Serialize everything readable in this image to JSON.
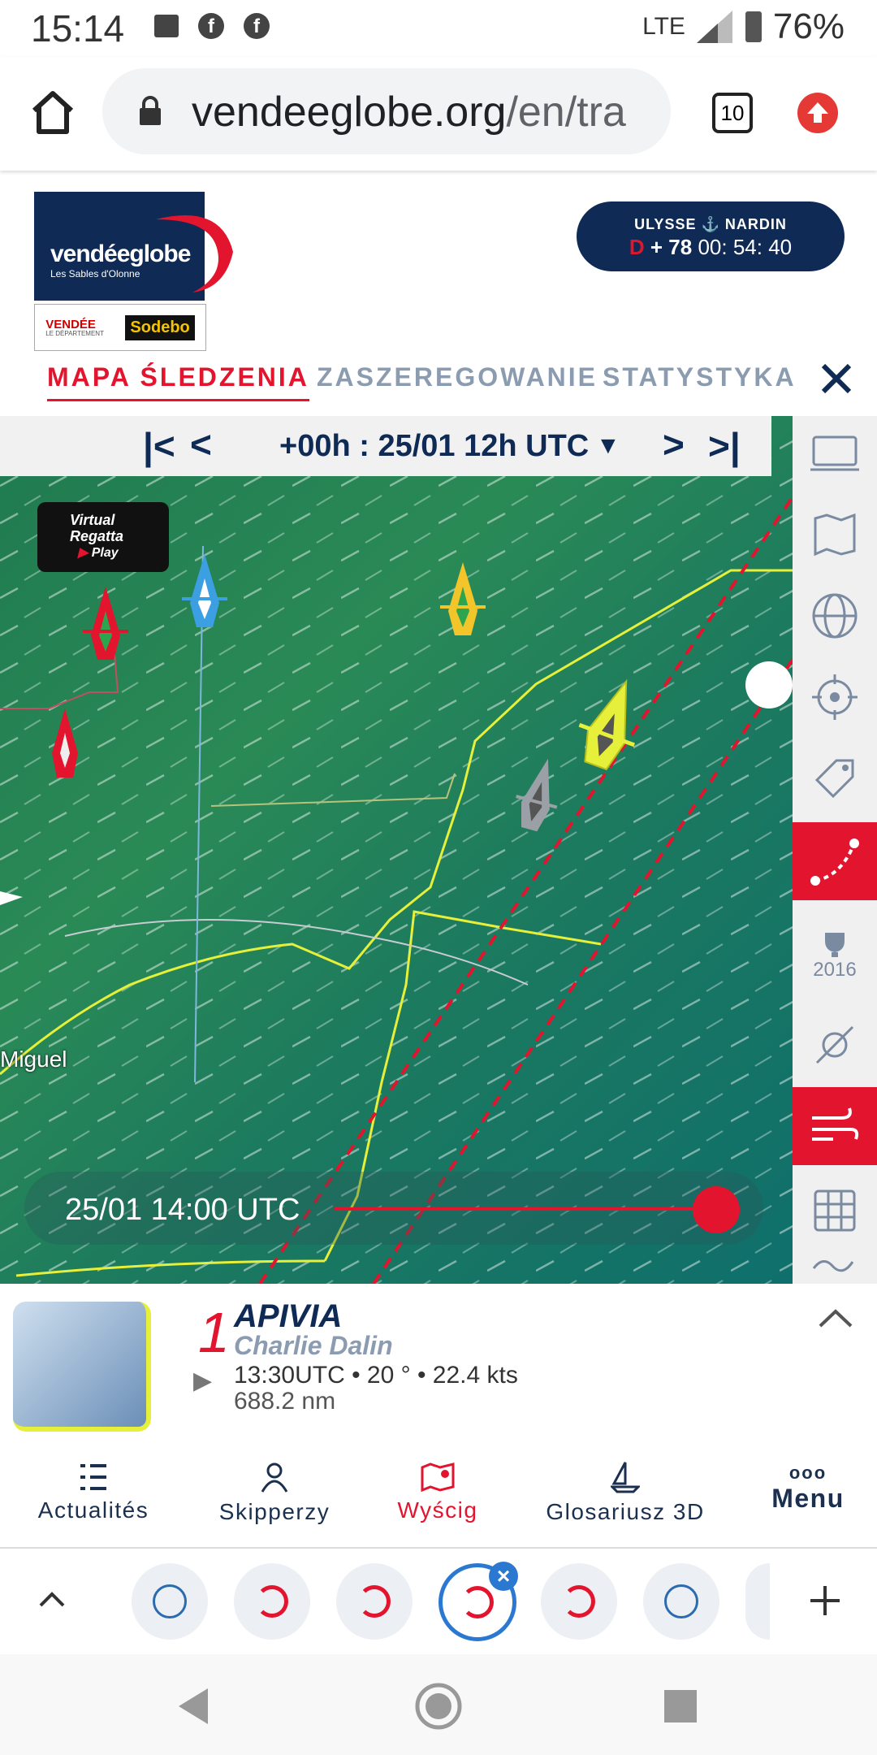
{
  "status_bar": {
    "time": "15:14",
    "network": "LTE",
    "battery": "76%"
  },
  "browser": {
    "url_main": "vendeeglobe.org",
    "url_rest": "/en/tra",
    "tab_count": "10"
  },
  "header": {
    "logo_text": "vendéeglobe",
    "logo_sub": "Les Sables d'Olonne",
    "sponsor1": "VENDÉE",
    "sponsor1_sub": "LE DÉPARTEMENT",
    "sponsor2": "Sodebo",
    "countdown_brand_left": "ULYSSE",
    "countdown_brand_right": "NARDIN",
    "countdown_d": "D",
    "countdown_days": "+ 78",
    "countdown_time": "00: 54: 40"
  },
  "tabs": [
    {
      "label": "MAPA ŚLEDZENIA",
      "active": true
    },
    {
      "label": "ZASZEREGOWANIE",
      "active": false
    },
    {
      "label": "STATYSTYKA",
      "active": false
    }
  ],
  "map": {
    "time_label": "+00h : 25/01 12h UTC",
    "virtual_regatta_line1": "Virtual",
    "virtual_regatta_line2": "Regatta",
    "virtual_regatta_play": "Play",
    "place_label": "Miguel",
    "slider_time": "25/01 14:00 UTC",
    "slider_progress": 1.0
  },
  "sidebar": {
    "trophy_year": "2016"
  },
  "skipper_card": {
    "rank": "1",
    "boat": "APIVIA",
    "skipper": "Charlie Dalin",
    "stats": "13:30UTC • 20 ° • 22.4 kts",
    "distance": "688.2 nm"
  },
  "bottom_nav": [
    {
      "label": "Actualités",
      "icon": "list-icon",
      "active": false
    },
    {
      "label": "Skipperzy",
      "icon": "person-icon",
      "active": false
    },
    {
      "label": "Wyścig",
      "icon": "map-pin-icon",
      "active": true
    },
    {
      "label": "Glosariusz 3D",
      "icon": "sailboat-icon",
      "active": false
    },
    {
      "label": "Menu",
      "icon": "dots-icon",
      "active": false
    }
  ],
  "colors": {
    "accent_red": "#e3142d",
    "navy": "#0f2b55",
    "map_green": "#1f7a50"
  }
}
